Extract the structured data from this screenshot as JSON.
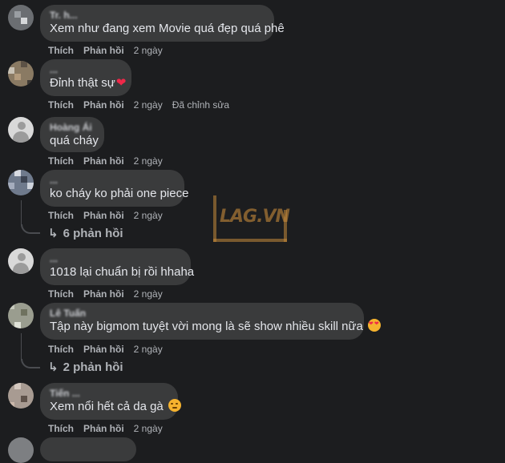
{
  "comments": [
    {
      "name": "Tr. h... ",
      "text": "Xem như đang xem Movie quá đẹp quá phê",
      "like": "Thích",
      "reply": "Phản hồi",
      "time": "2 ngày"
    },
    {
      "name": "...",
      "text": "Đỉnh thật sự",
      "emoji": "heart-icon",
      "like": "Thích",
      "reply": "Phản hồi",
      "time": "2 ngày",
      "edited": "Đã chỉnh sửa"
    },
    {
      "name": "Hoàng Ái",
      "text": "quá cháy",
      "like": "Thích",
      "reply": "Phản hồi",
      "time": "2 ngày"
    },
    {
      "name": "...",
      "text": "ko cháy ko phải one piece",
      "like": "Thích",
      "reply": "Phản hồi",
      "time": "2 ngày",
      "replies": "6 phản hồi"
    },
    {
      "name": "...",
      "text": "1018 lại chuẩn bị rồi hhaha",
      "like": "Thích",
      "reply": "Phản hồi",
      "time": "2 ngày"
    },
    {
      "name": "Lê Tuấn",
      "text": "Tập này bigmom tuyệt vời mong là sẽ show nhiều skill nữa",
      "emoji": "smiling-face-with-hearts-icon",
      "like": "Thích",
      "reply": "Phản hồi",
      "time": "2 ngày",
      "replies": "2 phản hồi"
    },
    {
      "name": "Tiến ...",
      "text": "Xem nổi hết cả da gà",
      "emoji": "smirking-face-icon",
      "like": "Thích",
      "reply": "Phản hồi",
      "time": "2 ngày"
    }
  ],
  "watermark": {
    "text": "LAG.VN"
  },
  "colors": {
    "background": "#1c1d1f",
    "bubble": "#3a3b3c",
    "text": "#e4e6eb",
    "secondary": "#b0b3b8",
    "heart": "#f02849",
    "watermark": "#c68a3b"
  }
}
